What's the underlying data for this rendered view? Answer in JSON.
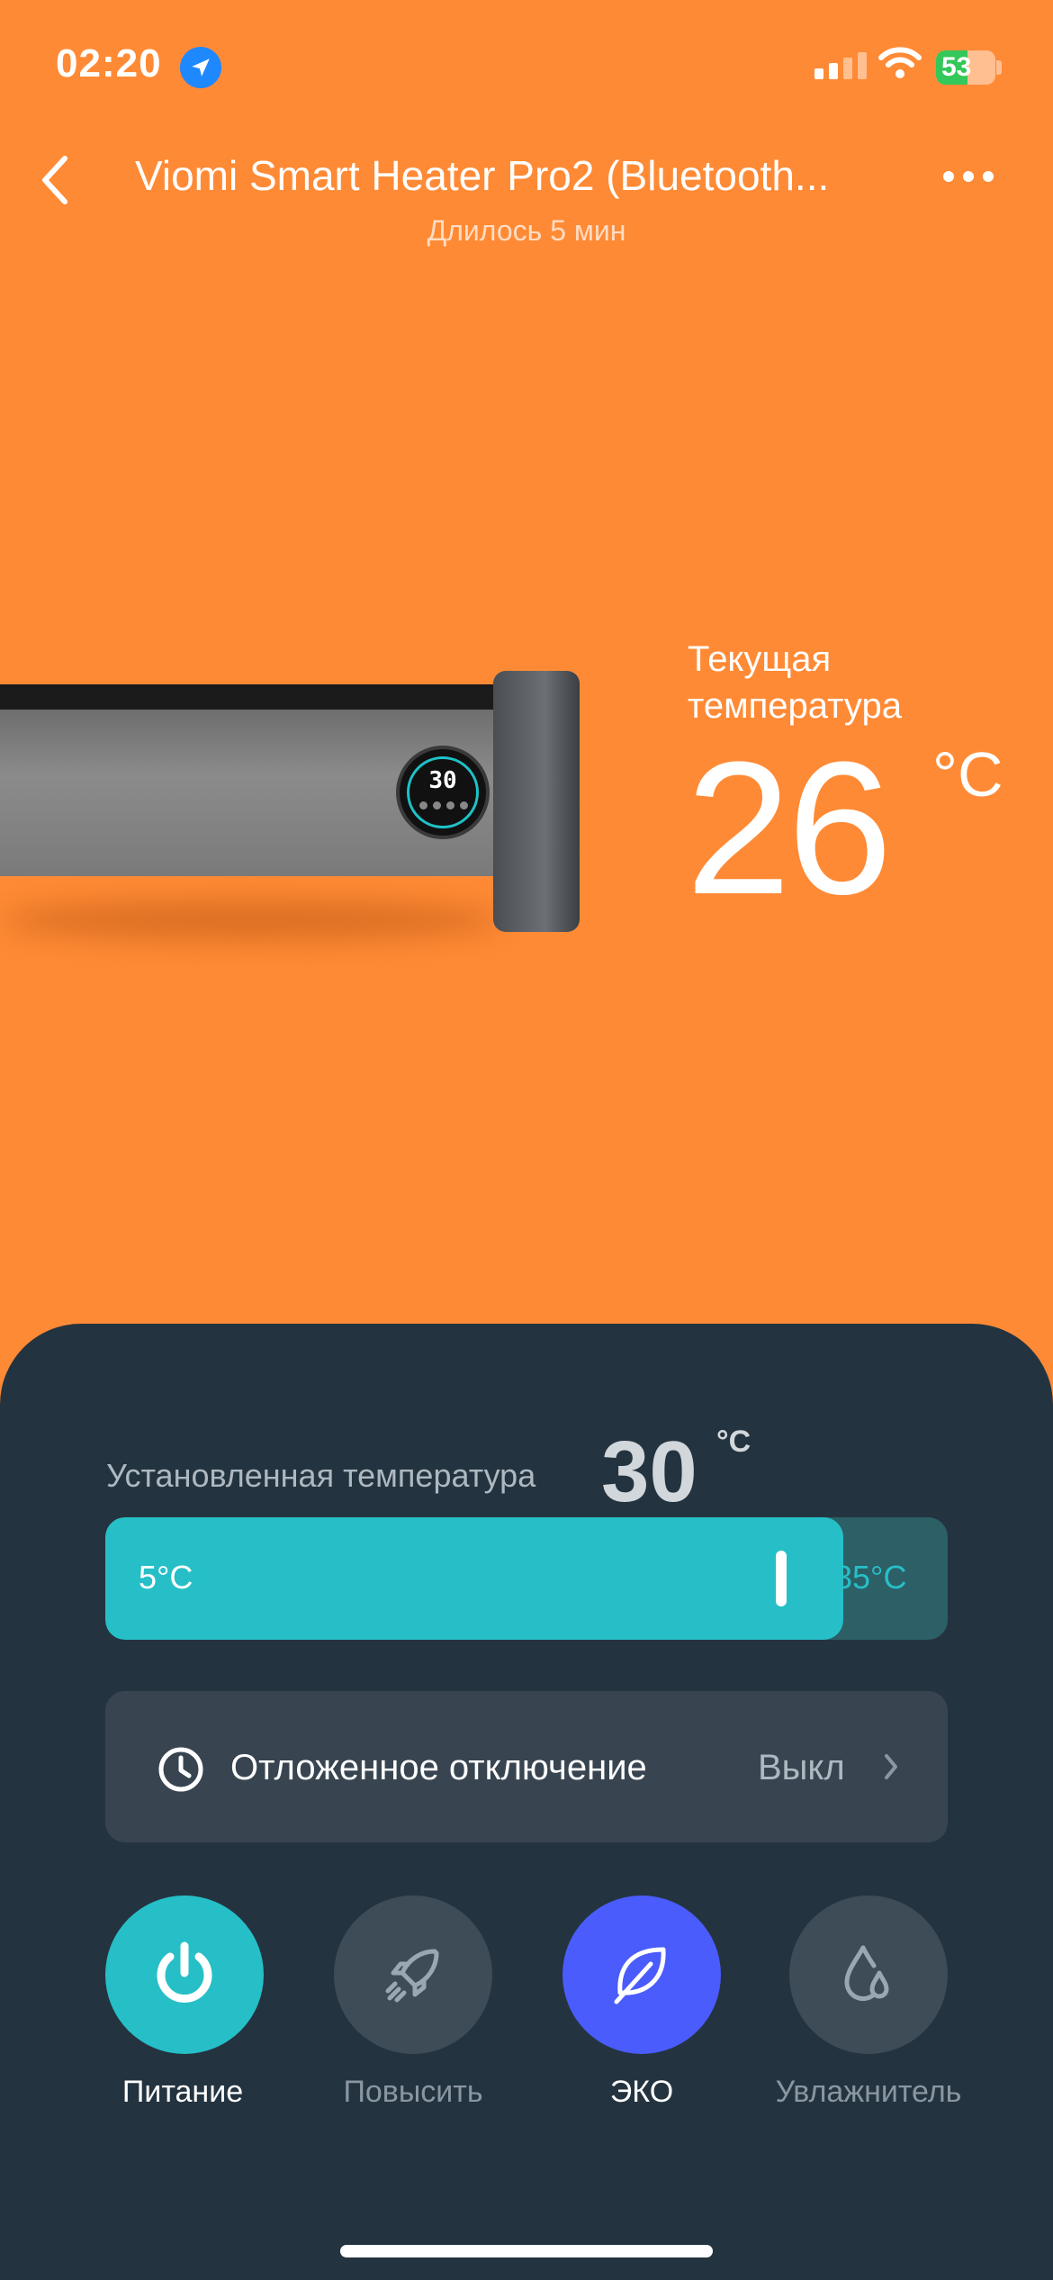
{
  "status_bar": {
    "time": "02:20",
    "battery": "53",
    "battery_level": 0.53
  },
  "header": {
    "title": "Viomi Smart Heater Pro2 (Bluetooth...",
    "subtitle": "Длилось 5 мин"
  },
  "device": {
    "display_value": "30"
  },
  "current_temperature": {
    "label": "Текущая температура",
    "value": "26",
    "unit": "°C"
  },
  "set_temperature": {
    "label": "Установленная температура",
    "value": "30",
    "unit": "°C",
    "min_label": "5°C",
    "max_label": "35°C",
    "min": 5,
    "max": 35,
    "current": 30
  },
  "timer": {
    "label": "Отложенное отключение",
    "value": "Выкл"
  },
  "controls": [
    {
      "label": "Питание",
      "icon": "power-icon",
      "state": "active",
      "color": "#26BFC7"
    },
    {
      "label": "Повысить",
      "icon": "rocket-icon",
      "state": "inactive",
      "color": "#3E4C58"
    },
    {
      "label": "ЭКО",
      "icon": "leaf-icon",
      "state": "active",
      "color": "#4A5CFB"
    },
    {
      "label": "Увлажнитель",
      "icon": "water-drop-icon",
      "state": "inactive",
      "color": "#3E4C58"
    }
  ],
  "colors": {
    "background": "#FF8A35",
    "panel": "#233440",
    "accent": "#26BFC7"
  }
}
